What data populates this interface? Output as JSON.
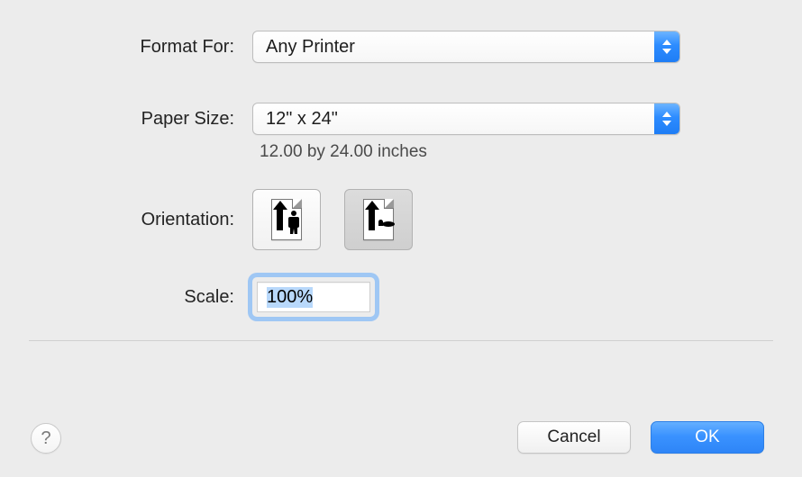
{
  "labels": {
    "format_for": "Format For:",
    "paper_size": "Paper Size:",
    "orientation": "Orientation:",
    "scale": "Scale:"
  },
  "format_for": {
    "selected": "Any Printer"
  },
  "paper_size": {
    "selected": "12\" x 24\"",
    "description": "12.00 by 24.00 inches"
  },
  "orientation": {
    "selected": "portrait"
  },
  "scale": {
    "value": "100%"
  },
  "buttons": {
    "cancel": "Cancel",
    "ok": "OK",
    "help": "?"
  }
}
